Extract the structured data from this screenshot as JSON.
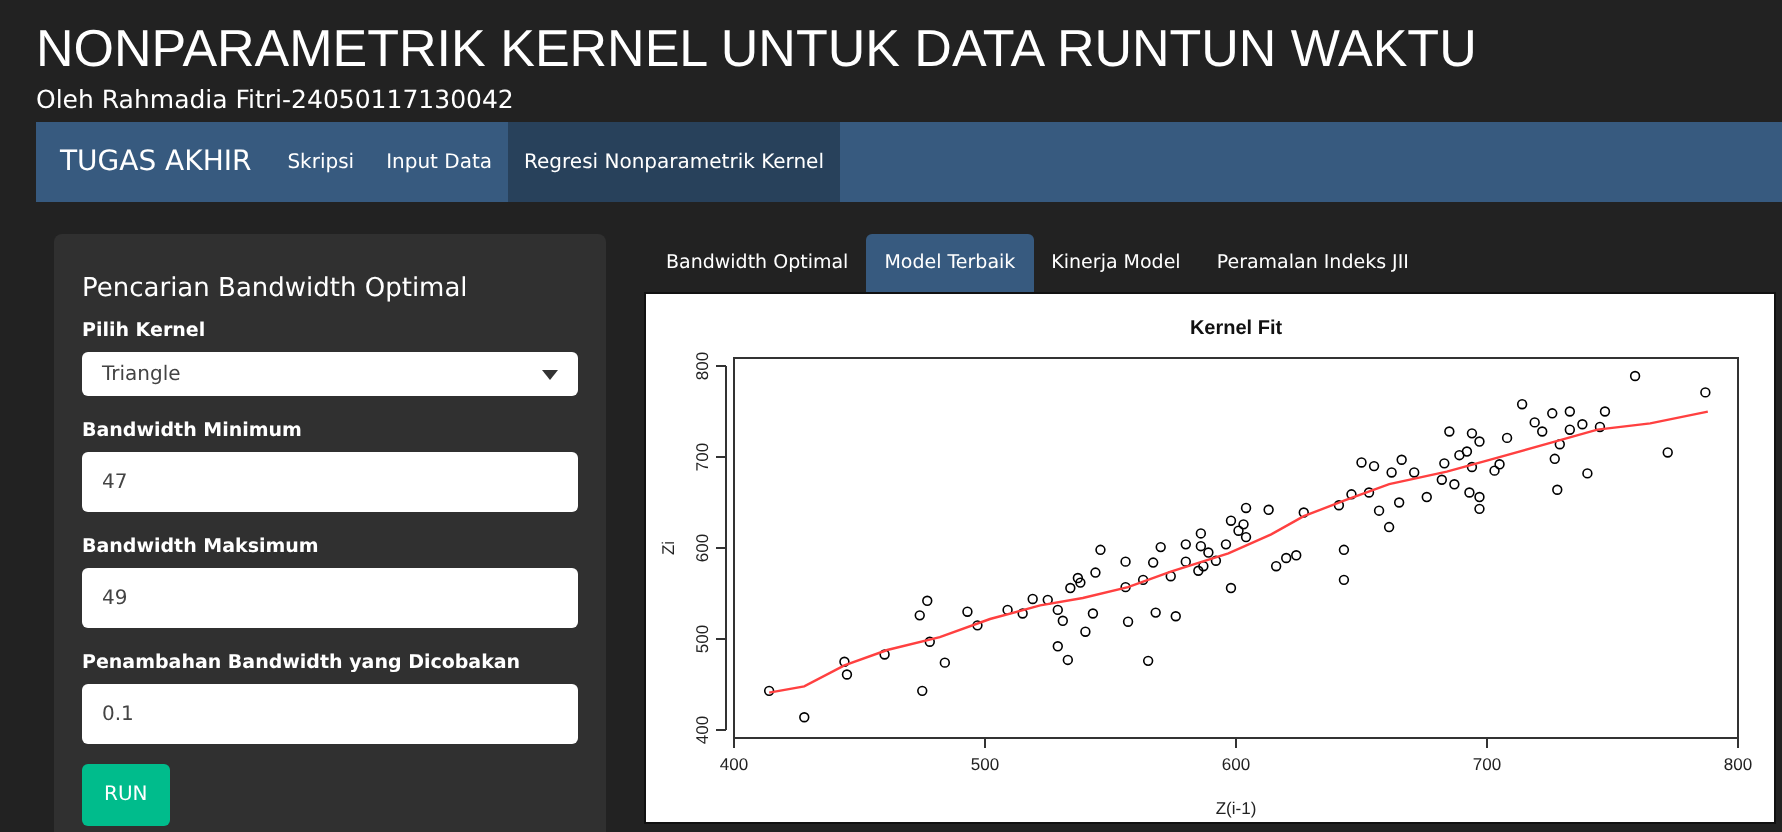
{
  "header": {
    "title": "NONPARAMETRIK KERNEL UNTUK DATA RUNTUN WAKTU",
    "subtitle": "Oleh Rahmadia Fitri-24050117130042"
  },
  "navbar": {
    "brand": "TUGAS AKHIR",
    "items": [
      {
        "label": "Skripsi",
        "selected": false
      },
      {
        "label": "Input Data",
        "selected": false
      },
      {
        "label": "Regresi Nonparametrik Kernel",
        "selected": true
      }
    ]
  },
  "sidebar": {
    "title": "Pencarian Bandwidth Optimal",
    "fields": [
      {
        "kind": "select",
        "label": "Pilih Kernel",
        "value": "Triangle"
      },
      {
        "kind": "input",
        "label": "Bandwidth Minimum",
        "value": "47"
      },
      {
        "kind": "input",
        "label": "Bandwidth Maksimum",
        "value": "49"
      },
      {
        "kind": "input",
        "label": "Penambahan Bandwidth yang Dicobakan",
        "value": "0.1"
      }
    ],
    "button": "RUN"
  },
  "tabs": [
    {
      "label": "Bandwidth Optimal",
      "selected": false
    },
    {
      "label": "Model Terbaik",
      "selected": true
    },
    {
      "label": "Kinerja Model",
      "selected": false
    },
    {
      "label": "Peramalan Indeks JII",
      "selected": false
    }
  ],
  "plot": {
    "chart_data": {
      "type": "scatter",
      "title": "Kernel Fit",
      "xlabel": "Z(i-1)",
      "ylabel": "Zi",
      "xlim": [
        400,
        800
      ],
      "ylim": [
        400,
        800
      ],
      "xticks": [
        400,
        500,
        600,
        700,
        800
      ],
      "yticks": [
        400,
        500,
        600,
        700,
        800
      ],
      "series": [
        {
          "color": "#000000",
          "x": [
            414,
            428,
            444,
            445,
            460,
            474,
            477,
            475,
            478,
            484,
            493,
            497,
            509,
            515,
            519,
            525,
            529,
            531,
            529,
            533,
            534,
            537,
            538,
            543,
            540,
            544,
            546,
            556,
            556,
            557,
            563,
            565,
            567,
            568,
            570,
            574,
            576,
            580,
            580,
            586,
            586,
            585,
            587,
            589,
            592,
            596,
            598,
            598,
            601,
            603,
            604,
            604,
            613,
            616,
            620,
            624,
            627,
            641,
            643,
            643,
            646,
            650,
            653,
            655,
            657,
            661,
            662,
            665,
            666,
            671,
            676,
            682,
            683,
            685,
            687,
            689,
            692,
            693,
            694,
            694,
            697,
            697,
            697,
            703,
            705,
            708,
            714,
            719,
            722,
            726,
            727,
            728,
            729,
            733,
            733,
            738,
            740,
            745,
            747,
            759,
            772,
            787
          ],
          "values": [
            443,
            414,
            475,
            461,
            483,
            526,
            542,
            443,
            497,
            474,
            530,
            515,
            532,
            528,
            544,
            543,
            532,
            520,
            492,
            477,
            556,
            567,
            562,
            528,
            508,
            573,
            598,
            585,
            557,
            519,
            565,
            476,
            584,
            529,
            601,
            569,
            525,
            604,
            585,
            616,
            602,
            575,
            580,
            595,
            586,
            604,
            630,
            556,
            619,
            626,
            612,
            644,
            642,
            580,
            589,
            592,
            639,
            647,
            598,
            565,
            659,
            694,
            661,
            690,
            641,
            623,
            683,
            650,
            697,
            683,
            656,
            675,
            693,
            728,
            670,
            702,
            706,
            661,
            726,
            689,
            717,
            656,
            643,
            685,
            692,
            721,
            758,
            738,
            728,
            748,
            698,
            664,
            714,
            750,
            730,
            736,
            682,
            733,
            750,
            789,
            705,
            771
          ]
        },
        {
          "type": "line",
          "color": "#ff4040",
          "x": [
            414,
            428,
            444,
            461,
            482,
            502,
            522,
            539,
            557,
            574,
            597,
            614,
            627,
            643,
            661,
            684,
            701,
            727,
            744,
            765,
            788
          ],
          "values": [
            441,
            448,
            471,
            488,
            502,
            522,
            537,
            545,
            557,
            574,
            594,
            615,
            635,
            652,
            670,
            684,
            697,
            717,
            730,
            737,
            750
          ]
        }
      ]
    }
  }
}
